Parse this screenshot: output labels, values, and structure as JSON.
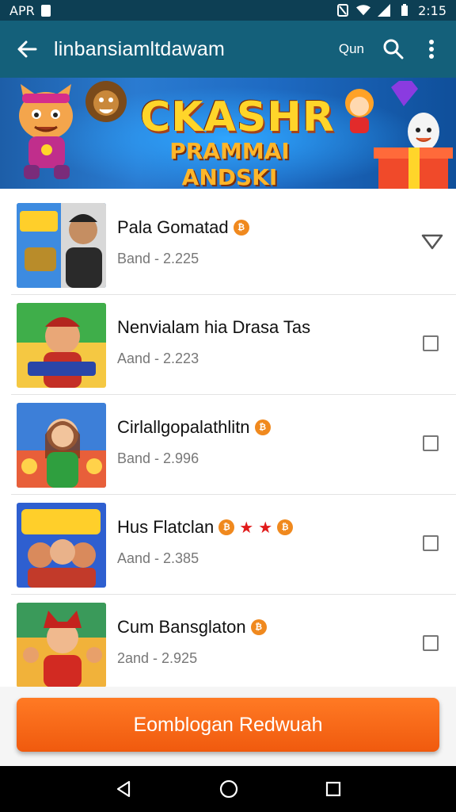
{
  "status_bar": {
    "carrier": "APR",
    "time": "2:15"
  },
  "app_bar": {
    "title": "linbansiamltdawam",
    "action_text": "Qun"
  },
  "banner": {
    "title": "CKASHR",
    "subtitle": "PRAMMAI ANDSKI"
  },
  "items": [
    {
      "title": "Pala Gomatad",
      "subtitle": "Band - 2.225",
      "control": "triangle",
      "badges": [
        "coin"
      ]
    },
    {
      "title": "Nenvialam hia Drasa Tas",
      "subtitle": "Aand - 2.223",
      "control": "checkbox",
      "badges": []
    },
    {
      "title": "Cirlallgopalathlitn",
      "subtitle": "Band - 2.996",
      "control": "checkbox",
      "badges": [
        "coin"
      ]
    },
    {
      "title": "Hus Flatclan",
      "subtitle": "Aand - 2.385",
      "control": "checkbox",
      "badges": [
        "coin",
        "star",
        "star",
        "coin"
      ]
    },
    {
      "title": "Cum Bansglaton",
      "subtitle": "2and - 2.925",
      "control": "checkbox",
      "badges": [
        "coin"
      ]
    }
  ],
  "cta": {
    "label": "Eomblogan Redwuah"
  },
  "colors": {
    "status_bar": "#0d3f54",
    "app_bar": "#14607a",
    "cta": "#f2661a",
    "coin": "#f0891e",
    "star": "#e11b1b"
  }
}
